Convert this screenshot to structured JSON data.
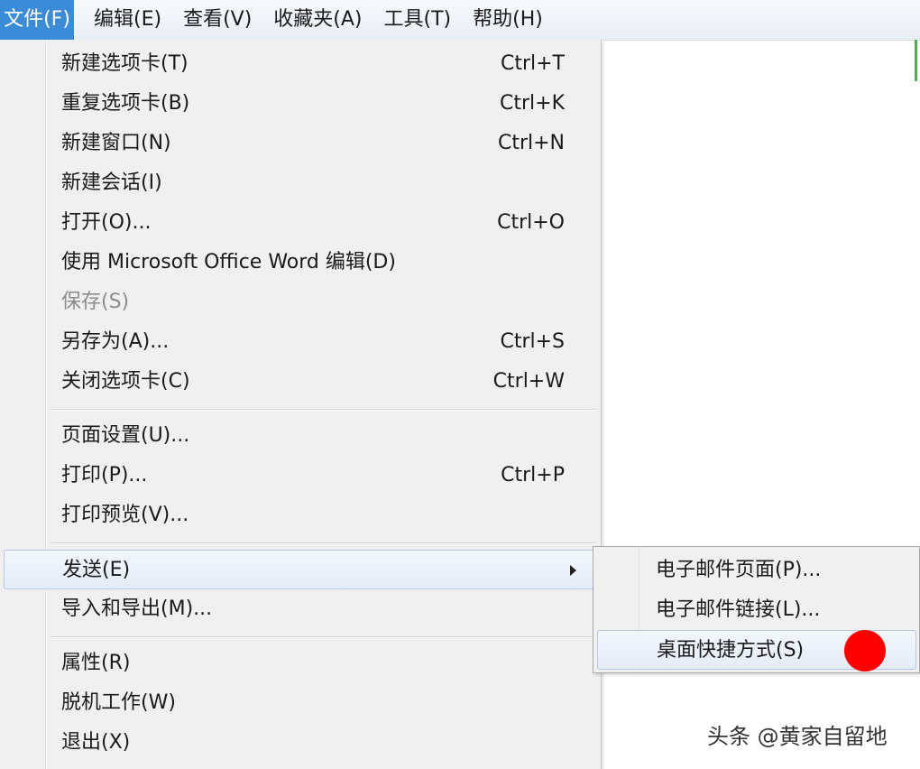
{
  "menubar": {
    "items": [
      {
        "label": "文件(F)"
      },
      {
        "label": "编辑(E)"
      },
      {
        "label": "查看(V)"
      },
      {
        "label": "收藏夹(A)"
      },
      {
        "label": "工具(T)"
      },
      {
        "label": "帮助(H)"
      }
    ]
  },
  "file_menu": {
    "items": [
      {
        "label": "新建选项卡(T)",
        "shortcut": "Ctrl+T"
      },
      {
        "label": "重复选项卡(B)",
        "shortcut": "Ctrl+K"
      },
      {
        "label": "新建窗口(N)",
        "shortcut": "Ctrl+N"
      },
      {
        "label": "新建会话(I)"
      },
      {
        "label": "打开(O)...",
        "shortcut": "Ctrl+O"
      },
      {
        "label": "使用 Microsoft Office Word 编辑(D)"
      },
      {
        "label": "保存(S)",
        "disabled": true
      },
      {
        "label": "另存为(A)...",
        "shortcut": "Ctrl+S"
      },
      {
        "label": "关闭选项卡(C)",
        "shortcut": "Ctrl+W"
      },
      {
        "label": "页面设置(U)..."
      },
      {
        "label": "打印(P)...",
        "shortcut": "Ctrl+P"
      },
      {
        "label": "打印预览(V)..."
      },
      {
        "label": "发送(E)",
        "has_submenu": true
      },
      {
        "label": "导入和导出(M)..."
      },
      {
        "label": "属性(R)"
      },
      {
        "label": "脱机工作(W)"
      },
      {
        "label": "退出(X)"
      }
    ]
  },
  "send_submenu": {
    "items": [
      {
        "label": "电子邮件页面(P)..."
      },
      {
        "label": "电子邮件链接(L)..."
      },
      {
        "label": "桌面快捷方式(S)"
      }
    ]
  },
  "annotation": {
    "color": "#ff0000"
  },
  "watermark": {
    "text": "头条 @黄家自留地"
  },
  "colors": {
    "accent": "#3a8bd8",
    "highlight_border": "#b2c8e6",
    "right_edge": "#4caf50"
  }
}
